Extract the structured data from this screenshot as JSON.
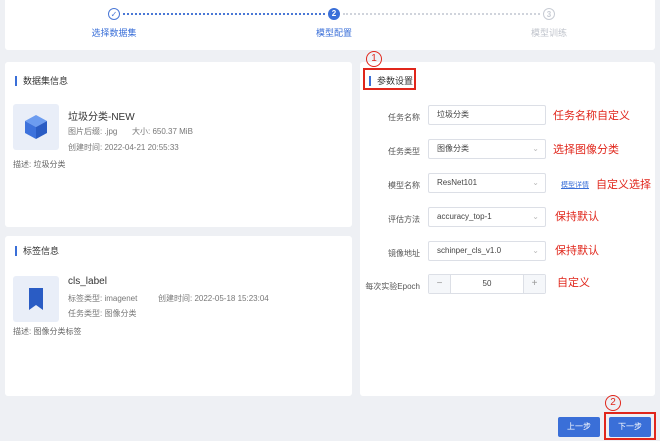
{
  "stepper": {
    "steps": [
      {
        "num": "✓",
        "label": "选择数据集"
      },
      {
        "num": "2",
        "label": "模型配置"
      },
      {
        "num": "3",
        "label": "模型训练"
      }
    ]
  },
  "dataset_panel": {
    "title": "数据集信息",
    "name": "垃圾分类-NEW",
    "image_format": "图片后缀: .jpg",
    "size": "大小: 650.37 MiB",
    "created": "创建时间: 2022-04-21 20:55:33",
    "description": "描述: 垃圾分类"
  },
  "label_panel": {
    "title": "标签信息",
    "name": "cls_label",
    "label_type": "标签类型: imagenet",
    "created": "创建时间: 2022-05-18 15:23:04",
    "task_type": "任务类型: 图像分类",
    "description": "描述: 图像分类标签"
  },
  "params_panel": {
    "title": "参数设置",
    "fields": {
      "task_name": {
        "label": "任务名称",
        "value": "垃圾分类"
      },
      "task_type": {
        "label": "任务类型",
        "value": "图像分类"
      },
      "model_name": {
        "label": "模型名称",
        "value": "ResNet101"
      },
      "metric": {
        "label": "评估方法",
        "value": "accuracy_top-1"
      },
      "image": {
        "label": "镜像地址",
        "value": "schinper_cls_v1.0"
      },
      "epoch": {
        "label": "每次实验Epoch",
        "value": "50",
        "minus": "−",
        "plus": "+"
      }
    },
    "model_detail_link": "模型详情"
  },
  "annotations": {
    "a1": "任务名称自定义",
    "a2": "选择图像分类",
    "a3": "自定义选择",
    "a4": "保持默认",
    "a5": "保持默认",
    "a6": "自定义",
    "circle1": "1",
    "circle2": "2"
  },
  "buttons": {
    "prev": "上一步",
    "next": "下一步"
  },
  "colors": {
    "accent": "#3a6fd8",
    "annotation": "#e0261b"
  }
}
